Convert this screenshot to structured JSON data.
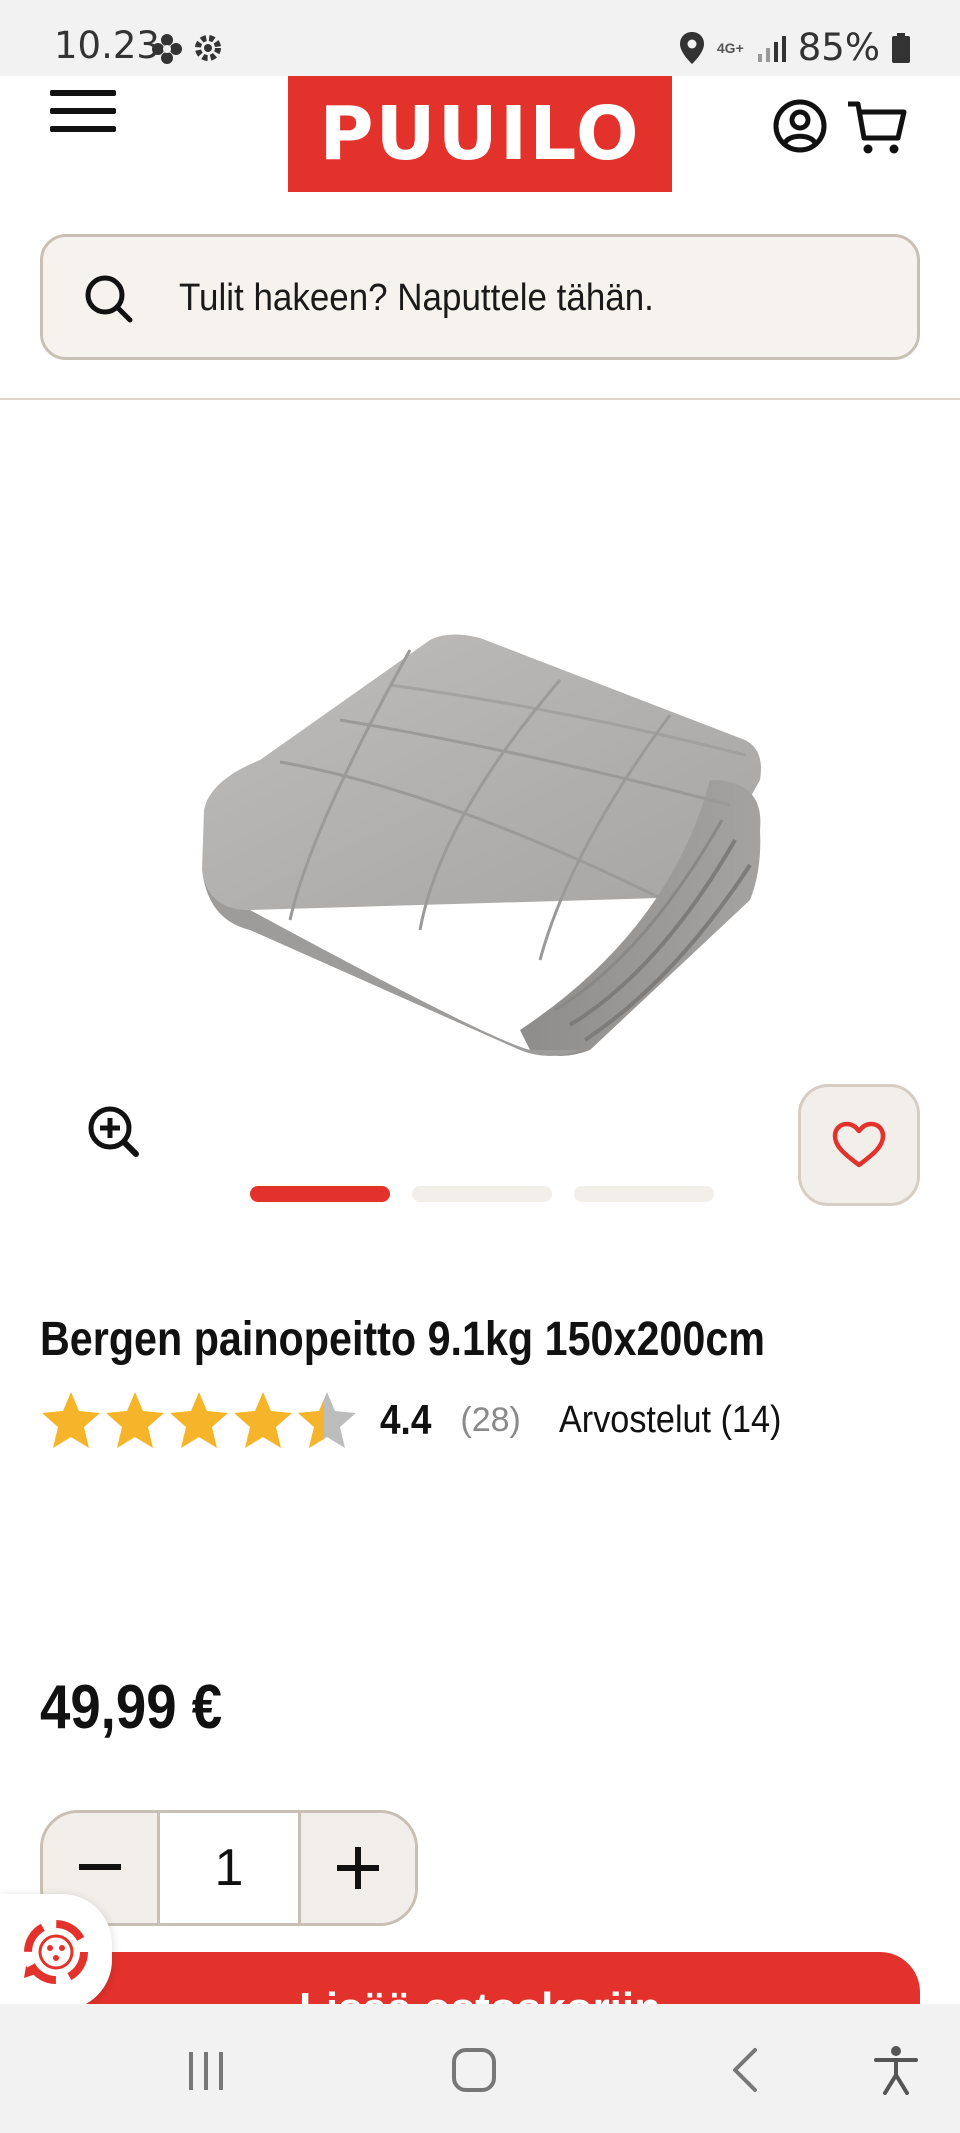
{
  "status_bar": {
    "time": "10.23",
    "battery": "85%",
    "network": "4G+"
  },
  "header": {
    "logo": "PUUILO",
    "search_placeholder": "Tulit hakeen? Naputtele tähän."
  },
  "product": {
    "title": "Bergen painopeitto 9.1kg 150x200cm",
    "rating": "4.4",
    "rating_count": "(28)",
    "reviews_link": "Arvostelut (14)",
    "stars": 4.4,
    "price": "49,99 €",
    "quantity": "1",
    "add_to_cart": "Lisää ostoskoriin"
  },
  "carousel": {
    "count": 3,
    "active_index": 0
  },
  "colors": {
    "brand_red": "#e2322b",
    "star": "#f5b42a",
    "star_empty": "#bdbdbd",
    "beige": "#f2eeea"
  }
}
